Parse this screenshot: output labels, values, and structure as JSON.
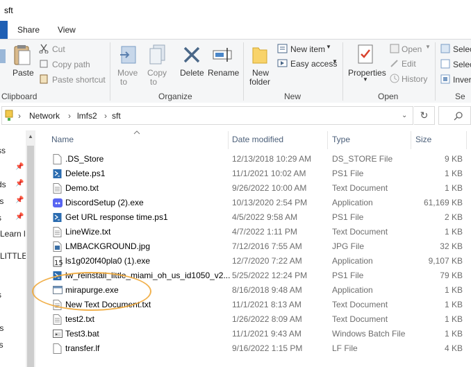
{
  "window": {
    "title": "sft"
  },
  "tabs": [
    {
      "label": "Share"
    },
    {
      "label": "View"
    }
  ],
  "ribbon": {
    "clipboard": {
      "copy": "Copy",
      "paste": "Paste",
      "cut": "Cut",
      "copy_path": "Copy path",
      "paste_shortcut": "Paste shortcut",
      "group_label": "Clipboard"
    },
    "organize": {
      "move_to": "Move",
      "move_to_sub": "to",
      "copy_to": "Copy",
      "copy_to_sub": "to",
      "delete": "Delete",
      "rename": "Rename",
      "group_label": "Organize"
    },
    "new": {
      "new_folder": "New",
      "new_folder_sub": "folder",
      "new_item": "New item",
      "easy_access": "Easy access",
      "group_label": "New"
    },
    "open": {
      "properties": "Properties",
      "open": "Open",
      "edit": "Edit",
      "history": "History",
      "group_label": "Open"
    },
    "select": {
      "select_all": "Selec",
      "select_none": "Selec",
      "invert": "Inver",
      "group_label": "Se"
    }
  },
  "address": {
    "crumbs": [
      "Network",
      "lmfs2",
      "sft"
    ]
  },
  "nav_pane": {
    "items": [
      "ss",
      "ds",
      "ts",
      "s",
      "Learn l",
      "LITTLE",
      "s",
      "ts",
      "ls"
    ]
  },
  "columns": {
    "name": "Name",
    "date": "Date modified",
    "type": "Type",
    "size": "Size"
  },
  "files": [
    {
      "name": ".DS_Store",
      "date": "12/13/2018 10:29 AM",
      "type": "DS_STORE File",
      "size": "9 KB",
      "icon": "blank-file-icon"
    },
    {
      "name": "Delete.ps1",
      "date": "11/1/2021 10:02 AM",
      "type": "PS1 File",
      "size": "1 KB",
      "icon": "powershell-icon"
    },
    {
      "name": "Demo.txt",
      "date": "9/26/2022 10:00 AM",
      "type": "Text Document",
      "size": "1 KB",
      "icon": "text-file-icon"
    },
    {
      "name": "DiscordSetup (2).exe",
      "date": "10/13/2020 2:54 PM",
      "type": "Application",
      "size": "61,169 KB",
      "icon": "discord-icon"
    },
    {
      "name": "Get URL response time.ps1",
      "date": "4/5/2022 9:58 AM",
      "type": "PS1 File",
      "size": "2 KB",
      "icon": "powershell-icon"
    },
    {
      "name": "LineWize.txt",
      "date": "4/7/2022 1:11 PM",
      "type": "Text Document",
      "size": "1 KB",
      "icon": "text-file-icon"
    },
    {
      "name": "LMBACKGROUND.jpg",
      "date": "7/12/2016 7:55 AM",
      "type": "JPG File",
      "size": "32 KB",
      "icon": "image-file-icon"
    },
    {
      "name": "ls1g020f40pla0 (1).exe",
      "date": "12/7/2020 7:22 AM",
      "type": "Application",
      "size": "9,107 KB",
      "icon": "installer-icon"
    },
    {
      "name": "lw_reinstall_little_miami_oh_us_id1050_v2...",
      "date": "5/25/2022 12:24 PM",
      "type": "PS1 File",
      "size": "79 KB",
      "icon": "powershell-icon"
    },
    {
      "name": "mirapurge.exe",
      "date": "8/16/2018 9:48 AM",
      "type": "Application",
      "size": "1 KB",
      "icon": "application-icon"
    },
    {
      "name": "New Text Document.txt",
      "date": "11/1/2021 8:13 AM",
      "type": "Text Document",
      "size": "1 KB",
      "icon": "text-file-icon"
    },
    {
      "name": "test2.txt",
      "date": "1/26/2022 8:09 AM",
      "type": "Text Document",
      "size": "1 KB",
      "icon": "text-file-icon"
    },
    {
      "name": "Test3.bat",
      "date": "11/1/2021 9:43 AM",
      "type": "Windows Batch File",
      "size": "1 KB",
      "icon": "batch-file-icon"
    },
    {
      "name": "transfer.lf",
      "date": "9/16/2022 1:15 PM",
      "type": "LF File",
      "size": "4 KB",
      "icon": "blank-file-icon"
    }
  ],
  "colors": {
    "accent": "#1e5fb4",
    "annotation": "#f0a93a",
    "header_text": "#4c607a"
  }
}
